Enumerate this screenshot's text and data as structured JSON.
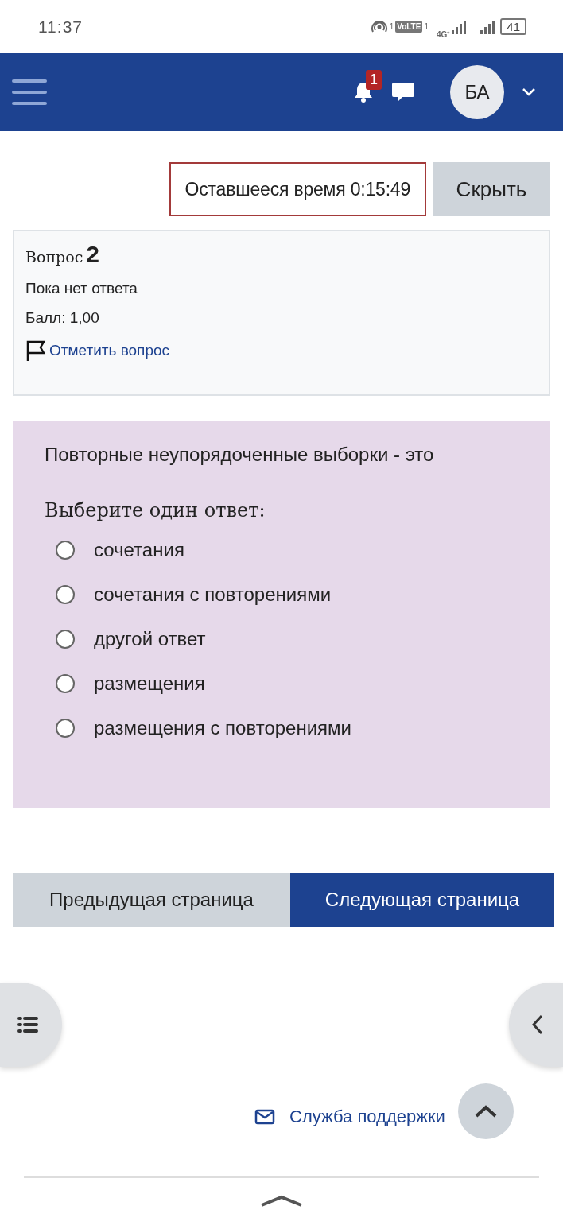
{
  "status_bar": {
    "time": "11:37",
    "hotspot_sup": "1",
    "volte": "VoLTE",
    "volte_sub": "1",
    "network": "4G⁺",
    "battery": "41"
  },
  "header": {
    "notifications": "1",
    "avatar": "БА"
  },
  "timer": {
    "text": "Оставшееся время 0:15:49",
    "hide_button": "Скрыть"
  },
  "info": {
    "label": "Вопрос",
    "number": "2",
    "status": "Пока нет ответа",
    "score": "Балл: 1,00",
    "flag": "Отметить вопрос"
  },
  "question": {
    "text": "Повторные неупорядоченные выборки - это",
    "prompt": "Выберите один ответ:",
    "options": [
      {
        "label": "сочетания",
        "selected": false
      },
      {
        "label": "сочетания с повторениями",
        "selected": false
      },
      {
        "label": "другой ответ",
        "selected": false
      },
      {
        "label": "размещения",
        "selected": false
      },
      {
        "label": "размещения с повторениями",
        "selected": false
      }
    ]
  },
  "nav": {
    "prev": "Предыдущая страница",
    "next": "Следующая страница"
  },
  "footer": {
    "support": "Служба поддержки"
  }
}
